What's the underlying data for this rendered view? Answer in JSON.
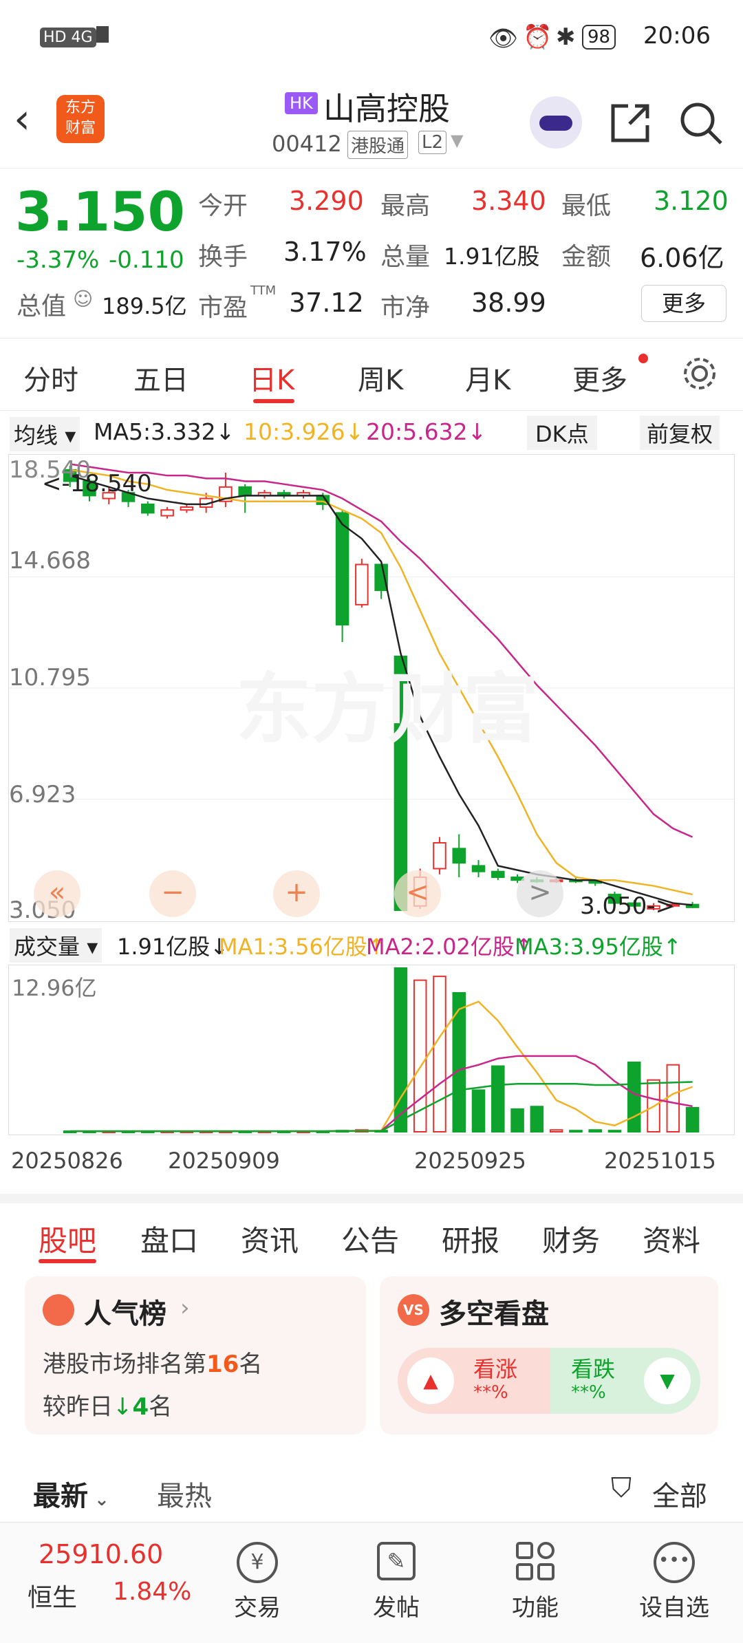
{
  "status_bar": {
    "left": "HD 4G",
    "battery": "98",
    "time": "20:06"
  },
  "header": {
    "market_badge": "HK",
    "name": "山高控股",
    "code": "00412",
    "tag1": "港股通",
    "tag2": "L2",
    "logo_line1": "东方",
    "logo_line2": "财富"
  },
  "quote": {
    "price": "3.150",
    "change_pct": "-3.37%",
    "change": "-0.110",
    "open_label": "今开",
    "open": "3.290",
    "high_label": "最高",
    "high": "3.340",
    "low_label": "最低",
    "low": "3.120",
    "turnover_label": "换手",
    "turnover": "3.17%",
    "volume_label": "总量",
    "volume": "1.91亿股",
    "amount_label": "金额",
    "amount": "6.06亿",
    "mktcap_label": "总值",
    "mktcap": "189.5亿",
    "pe_label": "市盈",
    "pe_sup": "TTM",
    "pe": "37.12",
    "pb_label": "市净",
    "pb": "38.99",
    "more_label": "更多"
  },
  "tabs": [
    "分时",
    "五日",
    "日K",
    "周K",
    "月K",
    "更多"
  ],
  "active_tab": "日K",
  "ma_bar": {
    "selector": "均线",
    "ma5": "MA5:3.332",
    "ma10": "10:3.926",
    "ma20": "20:5.632",
    "dk": "DK点",
    "adjust": "前复权"
  },
  "price_axis": {
    "top": "18.540",
    "l1": "14.668",
    "l2": "10.795",
    "l3": "6.923",
    "bottom": "3.050"
  },
  "chart_annotations": {
    "high_marker": "<-18.540",
    "low_marker": "3.050->",
    "watermark": "东方财富"
  },
  "vol_bar": {
    "selector": "成交量",
    "vol": "1.91亿股",
    "ma1": "MA1:3.56亿股",
    "ma2": "MA2:2.02亿股",
    "ma3": "MA3:3.95亿股",
    "max_label": "12.96亿"
  },
  "dates": [
    "20250826",
    "20250909",
    "20250925",
    "20251015"
  ],
  "chart_data": {
    "type": "candlestick",
    "ylim": [
      3.05,
      18.54
    ],
    "candles": [
      {
        "o": 18.4,
        "c": 18.0,
        "h": 18.54,
        "l": 17.8
      },
      {
        "o": 18.0,
        "c": 17.5,
        "h": 18.1,
        "l": 17.3
      },
      {
        "o": 17.4,
        "c": 17.6,
        "h": 17.8,
        "l": 17.2
      },
      {
        "o": 17.6,
        "c": 17.3,
        "h": 17.7,
        "l": 17.1
      },
      {
        "o": 17.2,
        "c": 16.9,
        "h": 17.3,
        "l": 16.8
      },
      {
        "o": 16.8,
        "c": 17.0,
        "h": 17.1,
        "l": 16.7
      },
      {
        "o": 17.0,
        "c": 17.1,
        "h": 17.2,
        "l": 16.9
      },
      {
        "o": 17.1,
        "c": 17.4,
        "h": 17.6,
        "l": 16.9
      },
      {
        "o": 17.3,
        "c": 17.8,
        "h": 18.3,
        "l": 17.1
      },
      {
        "o": 17.8,
        "c": 17.5,
        "h": 17.9,
        "l": 16.9
      },
      {
        "o": 17.5,
        "c": 17.6,
        "h": 17.7,
        "l": 17.4
      },
      {
        "o": 17.6,
        "c": 17.5,
        "h": 17.7,
        "l": 17.4
      },
      {
        "o": 17.5,
        "c": 17.6,
        "h": 17.7,
        "l": 17.4
      },
      {
        "o": 17.5,
        "c": 17.2,
        "h": 17.6,
        "l": 17.0
      },
      {
        "o": 16.9,
        "c": 13.0,
        "h": 17.0,
        "l": 12.4
      },
      {
        "o": 13.7,
        "c": 15.1,
        "h": 15.3,
        "l": 13.6
      },
      {
        "o": 15.1,
        "c": 14.2,
        "h": 15.1,
        "l": 13.9
      },
      {
        "o": 11.9,
        "c": 3.05,
        "h": 11.9,
        "l": 3.05
      },
      {
        "o": 3.2,
        "c": 4.2,
        "h": 4.5,
        "l": 3.1
      },
      {
        "o": 4.5,
        "c": 5.4,
        "h": 5.6,
        "l": 4.3
      },
      {
        "o": 5.2,
        "c": 4.7,
        "h": 5.7,
        "l": 4.2
      },
      {
        "o": 4.6,
        "c": 4.4,
        "h": 4.8,
        "l": 4.2
      },
      {
        "o": 4.4,
        "c": 4.2,
        "h": 4.5,
        "l": 4.1
      },
      {
        "o": 4.2,
        "c": 4.1,
        "h": 4.3,
        "l": 4.0
      },
      {
        "o": 4.1,
        "c": 4.05,
        "h": 4.2,
        "l": 4.0
      },
      {
        "o": 4.05,
        "c": 4.1,
        "h": 4.2,
        "l": 4.0
      },
      {
        "o": 4.1,
        "c": 4.05,
        "h": 4.2,
        "l": 4.0
      },
      {
        "o": 4.05,
        "c": 4.0,
        "h": 4.1,
        "l": 3.9
      },
      {
        "o": 3.6,
        "c": 3.3,
        "h": 3.7,
        "l": 3.2
      },
      {
        "o": 3.3,
        "c": 3.2,
        "h": 3.4,
        "l": 3.15
      },
      {
        "o": 3.1,
        "c": 3.2,
        "h": 3.3,
        "l": 3.05
      },
      {
        "o": 3.2,
        "c": 3.25,
        "h": 3.3,
        "l": 3.15
      },
      {
        "o": 3.25,
        "c": 3.15,
        "h": 3.34,
        "l": 3.12
      }
    ],
    "ma5": [
      18.2,
      18.0,
      17.8,
      17.6,
      17.4,
      17.3,
      17.2,
      17.2,
      17.4,
      17.5,
      17.5,
      17.5,
      17.5,
      17.5,
      16.5,
      16.0,
      15.2,
      12.0,
      9.8,
      8.4,
      7.1,
      6.0,
      4.6,
      4.45,
      4.3,
      4.2,
      4.1,
      4.1,
      3.9,
      3.7,
      3.5,
      3.3,
      3.23
    ],
    "ma10": [
      18.4,
      18.3,
      18.2,
      18.0,
      17.9,
      17.7,
      17.6,
      17.5,
      17.4,
      17.3,
      17.3,
      17.3,
      17.3,
      17.3,
      17.0,
      16.7,
      16.2,
      15.0,
      13.5,
      12.0,
      10.8,
      9.6,
      8.4,
      7.1,
      5.7,
      4.7,
      4.2,
      4.1,
      4.1,
      4.0,
      3.9,
      3.75,
      3.6
    ],
    "ma20": [
      18.6,
      18.5,
      18.4,
      18.3,
      18.3,
      18.2,
      18.2,
      18.1,
      18.1,
      18.0,
      18.0,
      17.9,
      17.8,
      17.7,
      17.4,
      17.0,
      16.6,
      15.9,
      15.3,
      14.6,
      13.9,
      13.2,
      12.5,
      11.7,
      10.9,
      10.2,
      9.5,
      8.8,
      8.0,
      7.2,
      6.4,
      5.9,
      5.6
    ],
    "volumes": [
      0.05,
      0.05,
      0.05,
      0.05,
      0.05,
      0.05,
      0.05,
      0.05,
      0.05,
      0.05,
      0.05,
      0.05,
      0.05,
      0.05,
      0.1,
      0.15,
      0.1,
      12.96,
      12.0,
      12.3,
      11.0,
      3.3,
      5.2,
      1.8,
      2.0,
      0.15,
      0.1,
      0.15,
      0.1,
      5.5,
      4.1,
      5.3,
      1.91
    ],
    "vol_ma1": [
      0.05,
      0.05,
      0.05,
      0.05,
      0.05,
      0.05,
      0.05,
      0.05,
      0.05,
      0.05,
      0.05,
      0.05,
      0.05,
      0.05,
      0.07,
      0.08,
      0.09,
      2.7,
      5.1,
      7.5,
      9.7,
      10.3,
      8.8,
      6.7,
      4.7,
      2.5,
      1.8,
      0.8,
      0.5,
      1.2,
      2.0,
      3.0,
      3.56
    ],
    "vol_ma2": [
      0.05,
      0.05,
      0.05,
      0.05,
      0.05,
      0.05,
      0.05,
      0.05,
      0.05,
      0.05,
      0.05,
      0.05,
      0.05,
      0.05,
      0.06,
      0.07,
      0.07,
      1.4,
      2.6,
      3.8,
      4.9,
      5.3,
      5.8,
      6.0,
      6.0,
      6.0,
      6.0,
      5.3,
      4.0,
      3.0,
      2.6,
      2.3,
      2.02
    ],
    "vol_ma3": [
      0.05,
      0.05,
      0.05,
      0.05,
      0.05,
      0.05,
      0.05,
      0.05,
      0.05,
      0.05,
      0.05,
      0.05,
      0.05,
      0.05,
      0.06,
      0.06,
      0.06,
      0.9,
      1.7,
      2.5,
      3.3,
      3.5,
      3.7,
      3.8,
      3.8,
      3.8,
      3.8,
      3.7,
      3.7,
      3.8,
      3.85,
      3.9,
      3.95
    ]
  },
  "controls": {
    "prev": "«",
    "minus": "−",
    "plus": "+",
    "left": "<",
    "right": ">"
  },
  "feature_tabs": [
    "股吧",
    "盘口",
    "资讯",
    "公告",
    "研报",
    "财务",
    "资料"
  ],
  "popular": {
    "title": "人气榜",
    "line1_prefix": "港股市场排名第",
    "rank": "16",
    "line1_suffix": "名",
    "line2_prefix": "较昨日",
    "change": "4",
    "line2_suffix": "名"
  },
  "vote": {
    "title": "多空看盘",
    "vs": "VS",
    "bull": "看涨",
    "bull_pct": "**%",
    "bear": "看跌",
    "bear_pct": "**%"
  },
  "sort": {
    "latest": "最新",
    "hot": "最热",
    "filter": "全部"
  },
  "bottom": {
    "index_value": "25910.60",
    "index_name": "恒生",
    "index_change": "1.84%",
    "trade": "交易",
    "post": "发帖",
    "func": "功能",
    "watch": "设自选"
  }
}
